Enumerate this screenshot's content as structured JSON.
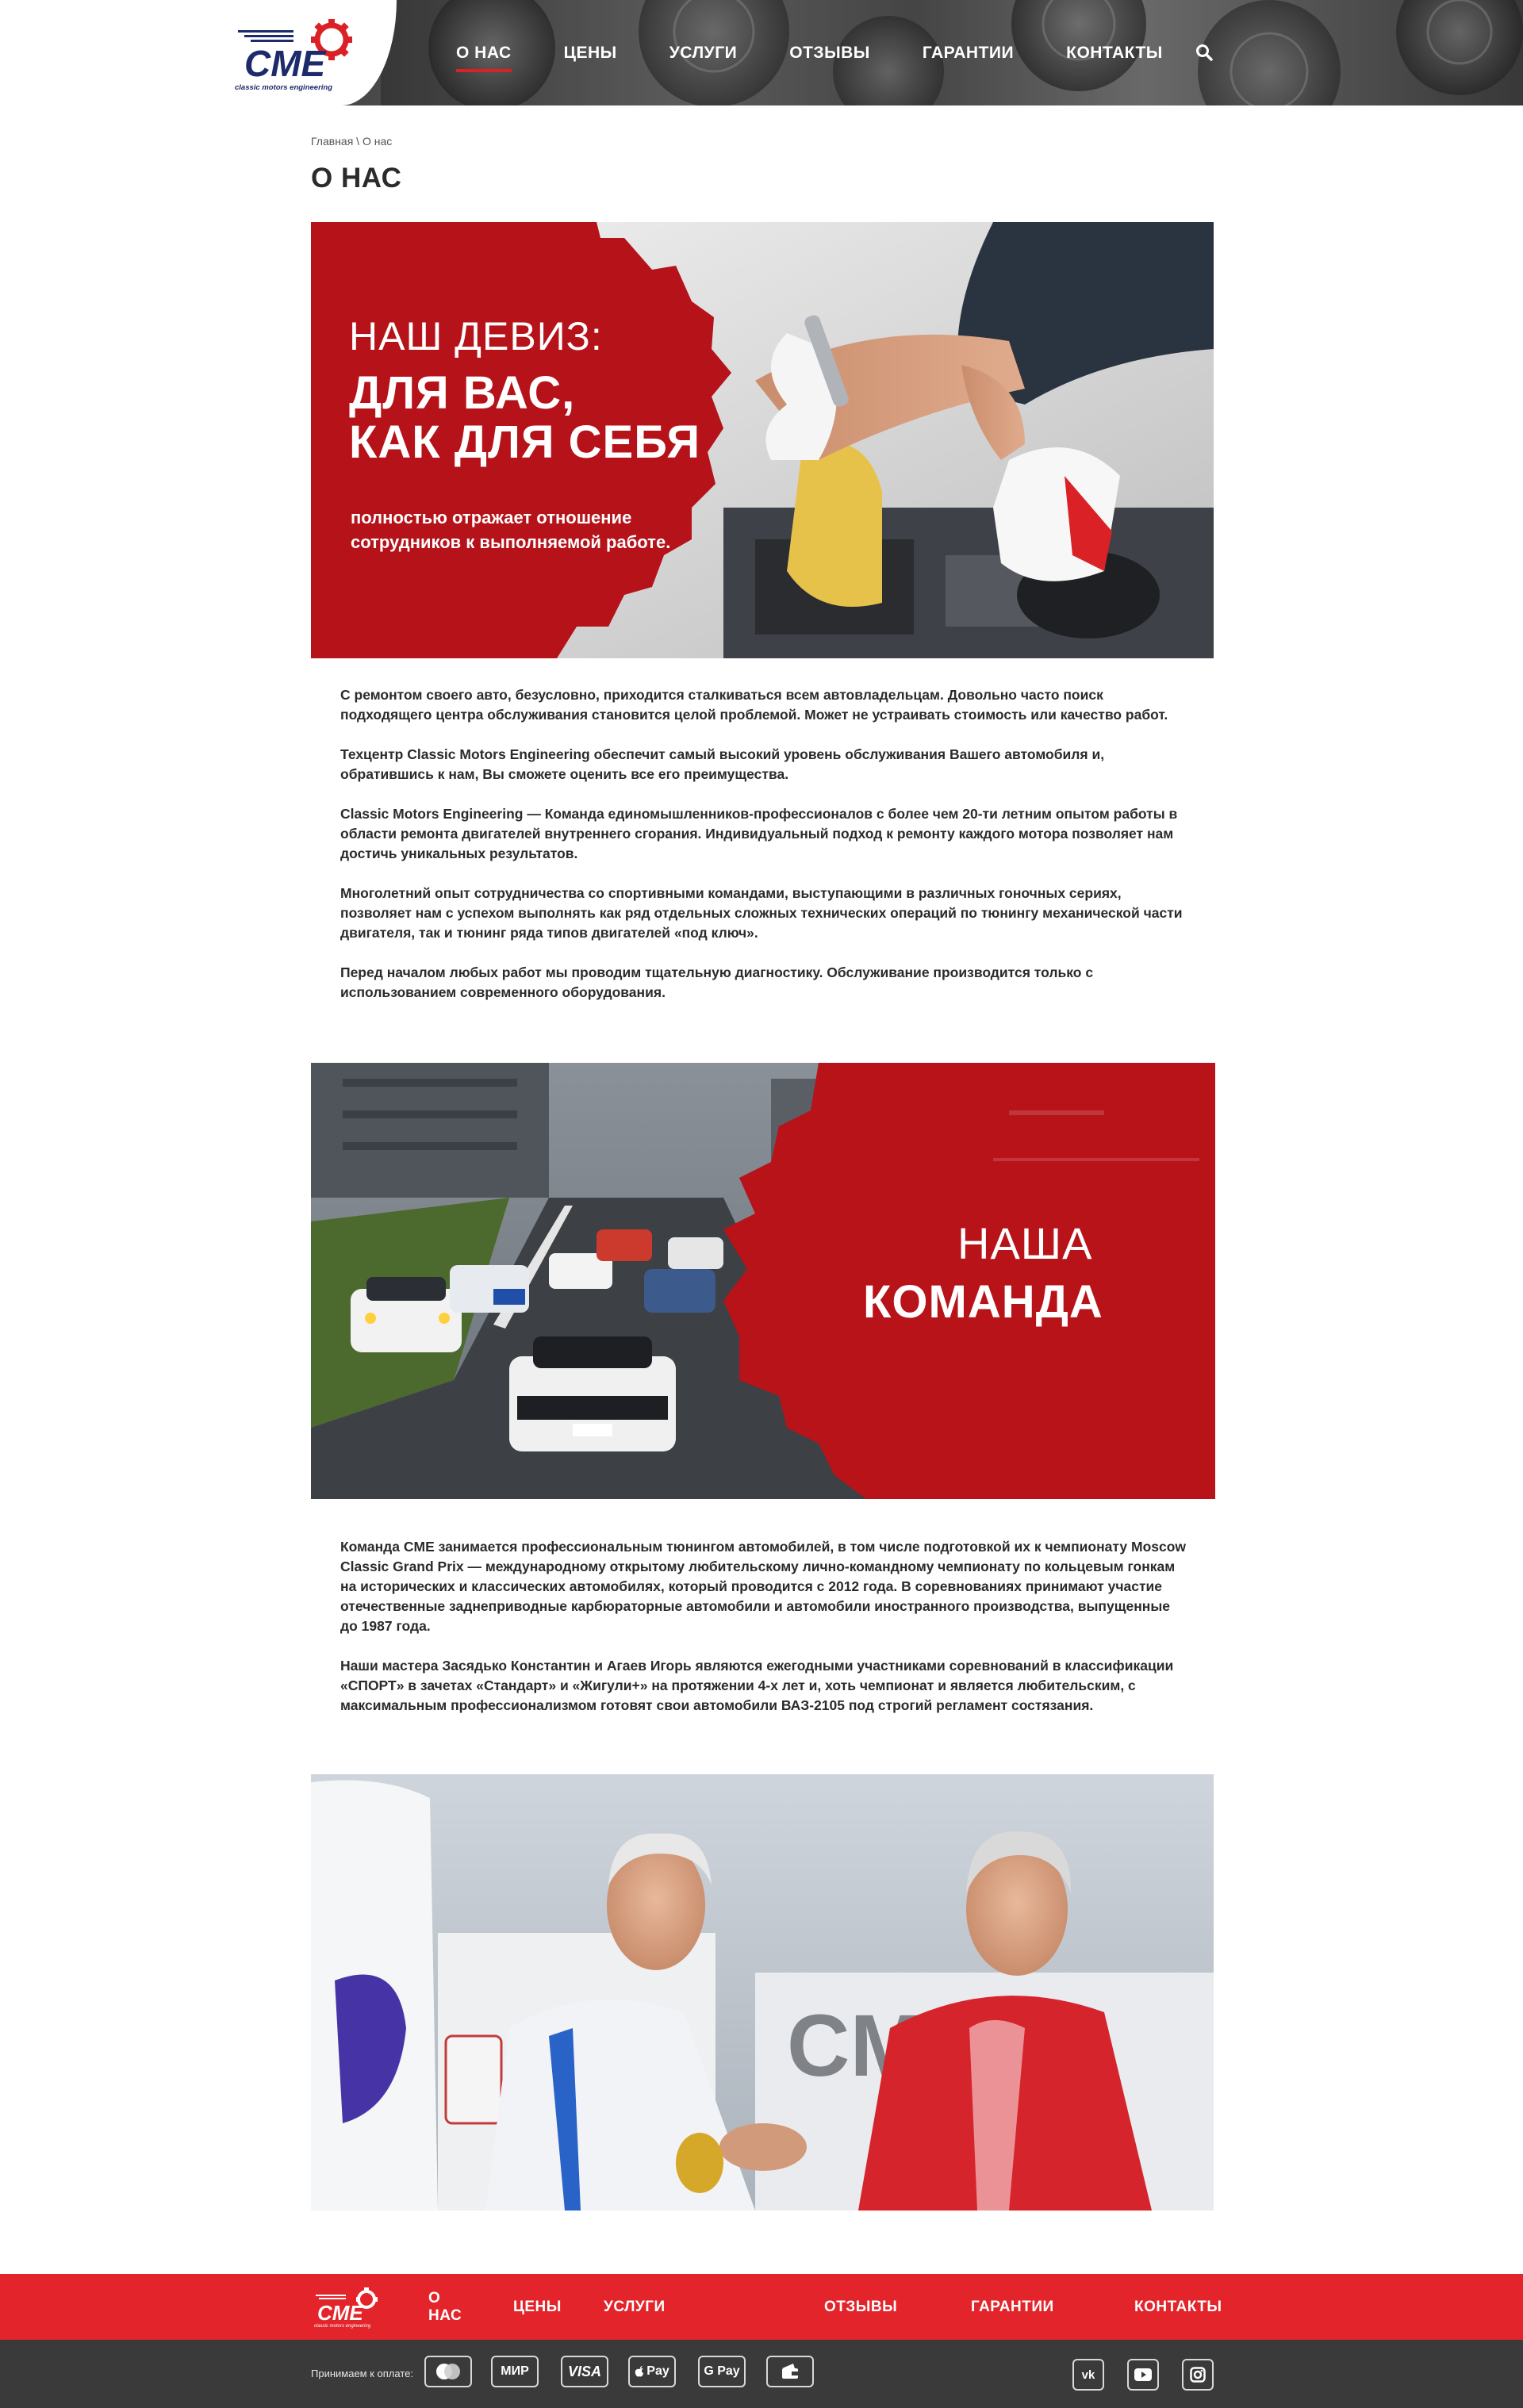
{
  "header": {
    "logo_text": "CME",
    "logo_subtitle": "classic motors engineering",
    "nav": [
      {
        "label": "О НАС",
        "active": true
      },
      {
        "label": "ЦЕНЫ",
        "active": false
      },
      {
        "label": "УСЛУГИ",
        "active": false
      },
      {
        "label": "ОТЗЫВЫ",
        "active": false
      },
      {
        "label": "ГАРАНТИИ",
        "active": false
      },
      {
        "label": "КОНТАКТЫ",
        "active": false
      }
    ],
    "search_icon": "search-icon"
  },
  "breadcrumb": "Главная \\ О нас",
  "page_title": "О НАС",
  "banner1": {
    "motto": "НАШ ДЕВИЗ:",
    "headline_line1": "ДЛЯ ВАС,",
    "headline_line2": "КАК ДЛЯ СЕБЯ",
    "subtitle_line1": "полностью отражает отношение",
    "subtitle_line2": "сотрудников к выполняемой работе."
  },
  "intro_paragraphs": [
    "С ремонтом своего авто, безусловно, приходится сталкиваться всем автовладельцам. Довольно часто поиск подходящего центра обслуживания становится целой проблемой. Может не устраивать стоимость или качество работ.",
    "Техцентр Classic Motors Engineering обеспечит самый высокий уровень обслуживания Вашего автомобиля и, обратившись к нам, Вы сможете оценить все его преимущества.",
    "Classic Motors Engineering — Команда единомышленников-профессионалов с более чем 20-ти летним опытом работы в области ремонта двигателей внутреннего сгорания. Индивидуальный подход к ремонту каждого мотора позволяет нам достичь уникальных результатов.",
    "Многолетний опыт сотрудничества со спортивными командами, выступающими в различных гоночных сериях, позволяет нам с успехом выполнять как ряд отдельных сложных технических операций по тюнингу механической части двигателя, так и тюнинг ряда типов двигателей «под ключ».",
    "Перед началом любых работ мы проводим тщательную диагностику. Обслуживание производится только с использованием современного оборудования."
  ],
  "banner2": {
    "line1": "НАША",
    "line2": "КОМАНДА"
  },
  "team_paragraphs": [
    "Команда CME занимается профессиональным тюнингом автомобилей, в том числе подготовкой их к чемпионату Moscow Classic Grand Prix — международному открытому любительскому лично-командному чемпионату по кольцевым гонкам на исторических и классических автомобилях, который проводится с 2012 года. В соревнованиях принимают участие отечественные заднеприводные карбюраторные автомобили и автомобили иностранного производства, выпущенные до 1987 года.",
    "Наши мастера Засядько Константин и Агаев Игорь являются ежегодными участниками соревнований в классификации «СПОРТ» в зачетах «Стандарт» и «Жигули+» на протяжении 4-х лет и, хоть чемпионат и является любительским, с максимальным профессионализмом готовят свои автомобили ВАЗ-2105 под строгий регламент состязания."
  ],
  "footer": {
    "logo_text": "CME",
    "links": [
      "О НАС",
      "ЦЕНЫ",
      "УСЛУГИ",
      "ОТЗЫВЫ",
      "ГАРАНТИИ",
      "КОНТАКТЫ"
    ],
    "payment_label": "Принимаем к оплате:",
    "payments": [
      "mastercard",
      "МИР",
      "VISA",
      "Pay",
      "G Pay",
      "wallet"
    ],
    "socials": [
      "vk-icon",
      "youtube-icon",
      "instagram-icon"
    ]
  },
  "colors": {
    "brand_red": "#d92126",
    "footer_red": "#e3242b",
    "footer_dark": "#3a3a3a"
  }
}
